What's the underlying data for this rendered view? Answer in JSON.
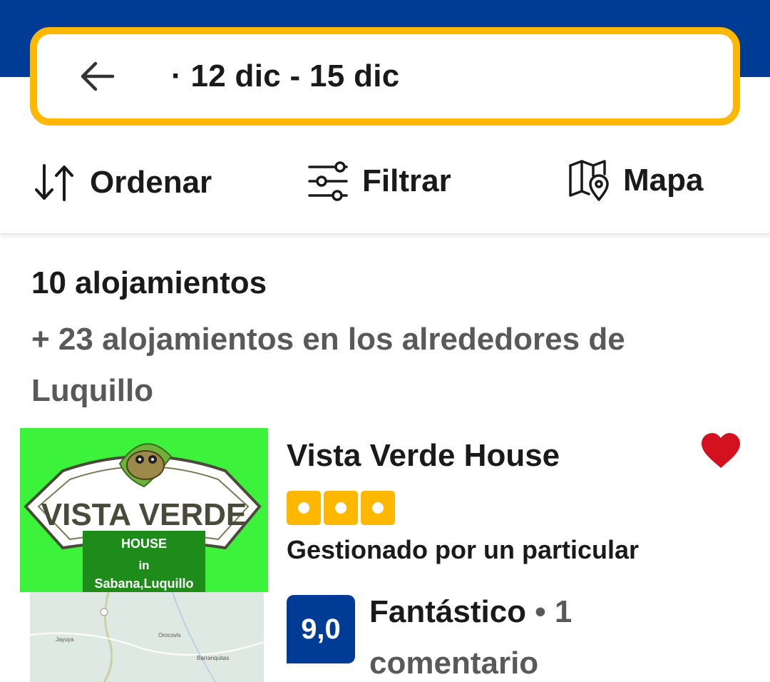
{
  "search": {
    "dates_label": "· 12 dic - 15 dic"
  },
  "toolbar": {
    "sort_label": "Ordenar",
    "filter_label": "Filtrar",
    "map_label": "Mapa"
  },
  "results": {
    "count_label": "10 alojamientos",
    "nearby_label": "+ 23 alojamientos en los alrededores de Luquillo"
  },
  "property": {
    "name": "Vista Verde House",
    "star_rating": 3,
    "managed_by": "Gestionado por un particular",
    "score": "9,0",
    "score_word": "Fantástico",
    "review_count": "• 1 comentario",
    "favorited": true,
    "logo": {
      "title": "VISTA VERDE",
      "subtitle": "HOUSE",
      "in": "in",
      "location": "Sabana,Luquillo"
    },
    "map_places": [
      "Jayuya",
      "Orocovis",
      "Barranquitas"
    ]
  },
  "colors": {
    "brand_blue": "#003b95",
    "accent_yellow": "#ffb700",
    "heart_red": "#d4111e",
    "logo_green": "#3df23a"
  },
  "icons": {
    "back": "arrow-left-icon",
    "sort": "sort-arrows-icon",
    "filter": "sliders-icon",
    "map": "map-pin-icon",
    "favorite": "heart-icon"
  }
}
